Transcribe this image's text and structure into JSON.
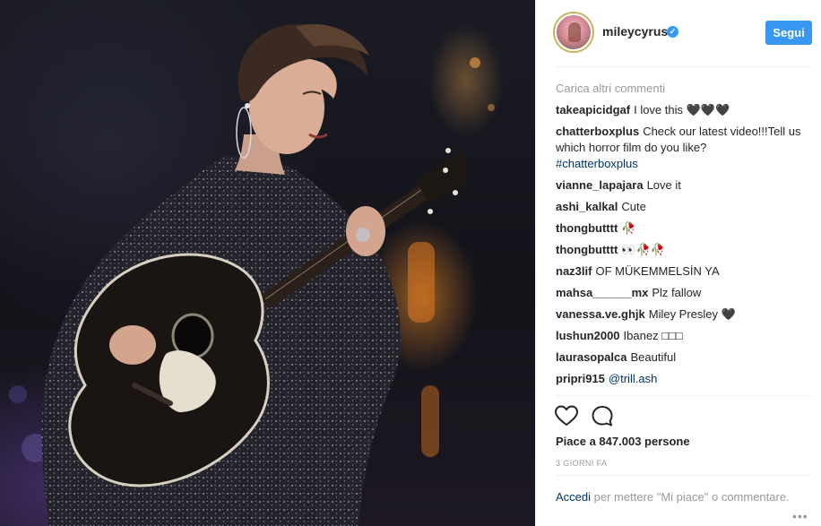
{
  "post": {
    "photo_label": "Photo of a performer playing an acoustic guitar on stage"
  },
  "header": {
    "username": "mileycyrus",
    "verified_icon": "verified-badge-icon",
    "follow_label": "Segui"
  },
  "comments": {
    "load_more": "Carica altri commenti",
    "items": [
      {
        "user": "takeapicidgaf",
        "text": "I love this 🖤🖤🖤"
      },
      {
        "user": "chatterboxplus",
        "text": "Check our latest video!!!Tell us which horror film do you like?",
        "hashtag": "#chatterboxplus"
      },
      {
        "user": "vianne_lapajara",
        "text": "Love it"
      },
      {
        "user": "ashi_kalkal",
        "text": "Cute"
      },
      {
        "user": "thongbutttt",
        "text": "🥀"
      },
      {
        "user": "thongbutttt",
        "text": "👀🥀🥀"
      },
      {
        "user": "naz3lif",
        "text": "OF MÜKEMMELSİN YA"
      },
      {
        "user": "mahsa______mx",
        "text": "Plz fallow"
      },
      {
        "user": "vanessa.ve.ghjk",
        "text": "Miley Presley 🖤"
      },
      {
        "user": "lushun2000",
        "text": "Ibanez □□□"
      },
      {
        "user": "laurasopalca",
        "text": "Beautiful"
      },
      {
        "user": "pripri915",
        "mention": "@trill.ash"
      }
    ]
  },
  "actions": {
    "like_icon": "heart-outline-icon",
    "comment_icon": "comment-bubble-icon",
    "likes_text": "Piace a 847.003 persone",
    "time_text": "3 GIORNI FA"
  },
  "footer": {
    "login_link": "Accedi",
    "login_rest": " per mettere \"Mi piace\" o commentare.",
    "more_icon": "more-options-icon"
  },
  "colors": {
    "accent": "#3897f0",
    "link": "#003569",
    "muted": "#999999",
    "text": "#262626"
  }
}
